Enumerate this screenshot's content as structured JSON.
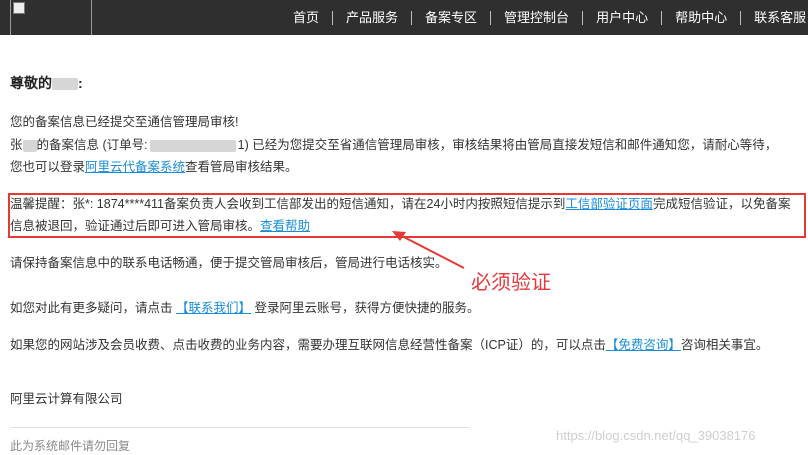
{
  "nav": {
    "items": [
      "首页",
      "产品服务",
      "备案专区",
      "管理控制台",
      "用户中心",
      "帮助中心",
      "联系客服"
    ]
  },
  "greeting": "尊敬的",
  "line1": "您的备案信息已经提交至通信管理局审核!",
  "line2": {
    "prefix": "张",
    "mid": "的备案信息 (订单号:",
    "suffix": "1) 已经为您提交至省通信管理局审核，审核结果将由管局直接发短信和邮件通知您，请耐心等待，"
  },
  "line3": {
    "prefix": "您也可以登录",
    "link": "阿里云代备案系统",
    "suffix": "查看管局审核结果。"
  },
  "notice": {
    "line1_prefix": "温馨提醒：张*: 1874****411备案负责人会收到工信部发出的短信通知，请在24小时内按照短信提示到",
    "line1_link": "工信部验证页面",
    "line1_suffix": "完成短信验证，以免备案",
    "line2_text": "信息被退回，验证通过后即可进入管局审核。",
    "line2_link": "查看帮助"
  },
  "line_phone": "请保持备案信息中的联系电话畅通，便于提交管局审核后，管局进行电话核实。",
  "annotation": "必须验证",
  "line_contact": {
    "prefix": "如您对此有更多疑问，请点击 ",
    "link": "【联系我们】",
    "suffix": " 登录阿里云账号，获得方便快捷的服务。"
  },
  "line_icp": {
    "prefix": "如果您的网站涉及会员收费、点击收费的业务内容，需要办理互联网信息经营性备案（ICP证）的，可以点击",
    "link": "【免费咨询】",
    "suffix": "咨询相关事宜。"
  },
  "company": "阿里云计算有限公司",
  "footer_note": "此为系统邮件请勿回复",
  "watermark": "https://blog.csdn.net/qq_39038176",
  "colors": {
    "topbar": "#2f2f2f",
    "link": "#1a8cd8",
    "highlight": "#e53935"
  }
}
